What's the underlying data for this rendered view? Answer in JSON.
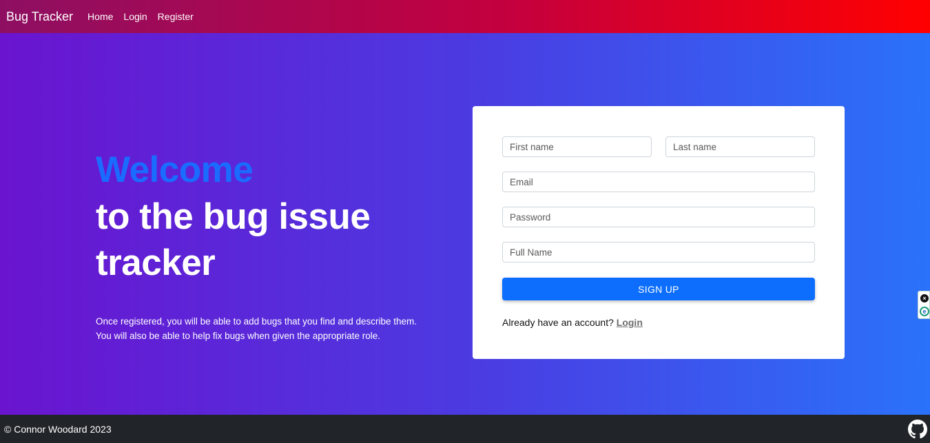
{
  "navbar": {
    "brand": "Bug Tracker",
    "links": [
      "Home",
      "Login",
      "Register"
    ],
    "gradient_colors": [
      "#8e0f62",
      "#c4003e",
      "#ff0000"
    ]
  },
  "hero": {
    "welcome": "Welcome",
    "headline_line1": "to the bug issue",
    "headline_line2": "tracker",
    "description_line1": "Once registered, you will be able to add bugs that you find and describe them.",
    "description_line2": "You will also be able to help fix bugs when given the appropriate role.",
    "accent_color": "#1a6cff"
  },
  "form": {
    "first_name_placeholder": "First name",
    "last_name_placeholder": "Last name",
    "email_placeholder": "Email",
    "password_placeholder": "Password",
    "full_name_placeholder": "Full Name",
    "submit_label": "SIGN UP",
    "submit_color": "#0d6efd",
    "already_text": "Already have an account?",
    "login_link": "Login"
  },
  "side_widget": {
    "close_icon": "close-icon",
    "extension_icon": "extension-icon",
    "close_glyph": "×",
    "extension_glyph": "e"
  },
  "footer": {
    "copyright": "© Connor Woodard 2023",
    "icon": "github-icon"
  }
}
